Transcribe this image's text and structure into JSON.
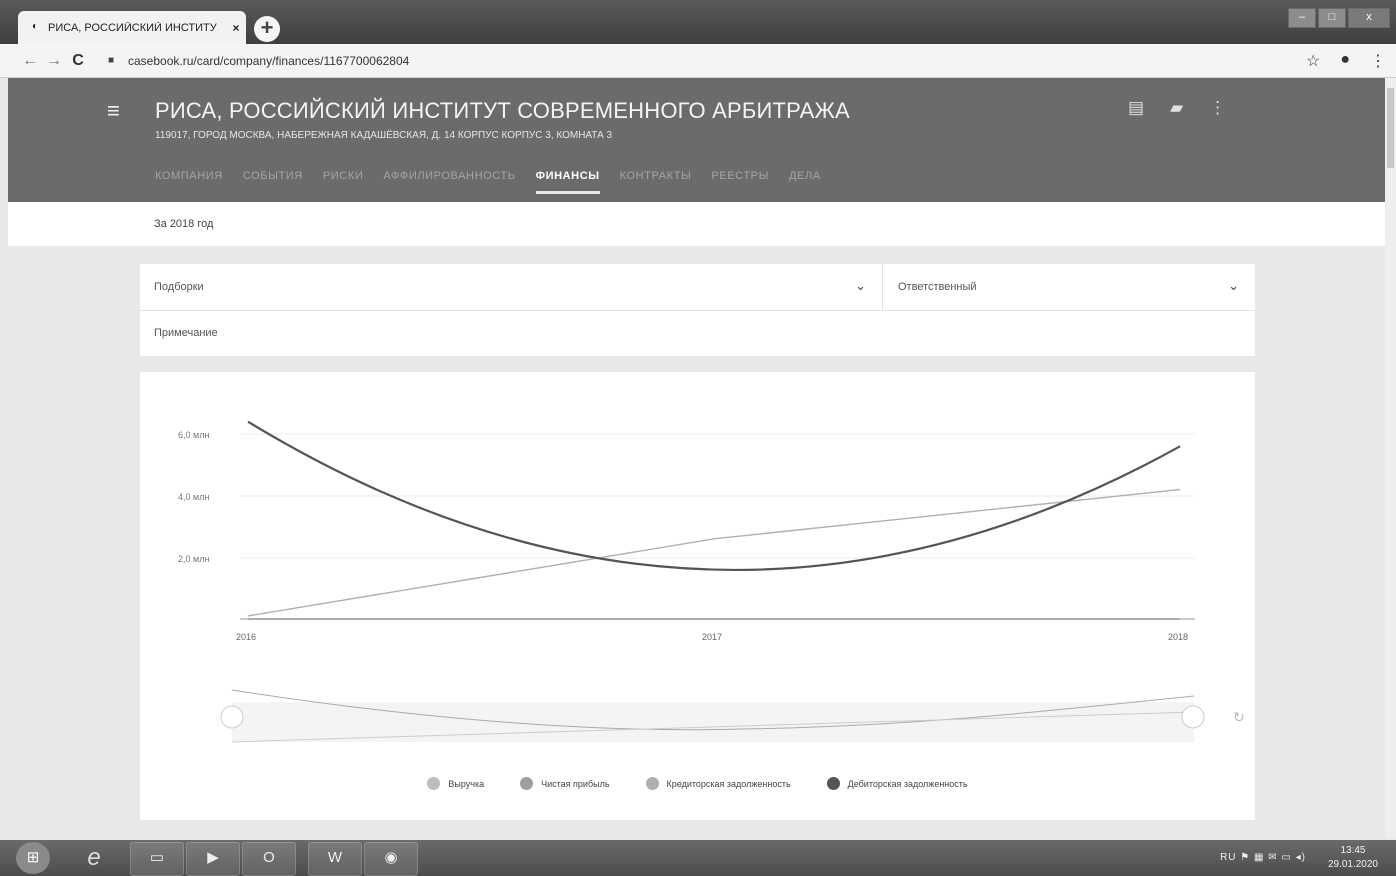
{
  "browser": {
    "tab_title": "РИСА, РОССИЙСКИЙ ИНСТИТУ",
    "tab_close": "×",
    "new_tab": "+",
    "url": "casebook.ru/card/company/finances/1167700062804",
    "window_controls": [
      "–",
      "□",
      "x"
    ]
  },
  "header": {
    "company_name": "РИСА, РОССИЙСКИЙ ИНСТИТУТ СОВРЕМЕННОГО АРБИТРАЖА",
    "address": "119017, ГОРОД МОСКВА, НАБЕРЕЖНАЯ КАДАШЁВСКАЯ, Д. 14 КОРПУС КОРПУС 3, КОМНАТА 3",
    "tabs": [
      {
        "label": "КОМПАНИЯ"
      },
      {
        "label": "СОБЫТИЯ"
      },
      {
        "label": "РИСКИ"
      },
      {
        "label": "АФФИЛИРОВАННОСТЬ"
      },
      {
        "label": "ФИНАНСЫ",
        "active": true
      },
      {
        "label": "КОНТРАКТЫ"
      },
      {
        "label": "РЕЕСТРЫ"
      },
      {
        "label": "ДЕЛА"
      }
    ]
  },
  "period": "За 2018 год",
  "filters": {
    "collections_label": "Подборки",
    "responsible_label": "Ответственный",
    "note_label": "Примечание"
  },
  "chart_data": {
    "type": "line",
    "x": [
      "2016",
      "2017",
      "2018"
    ],
    "y_ticks": [
      "6,0 млн",
      "4,0 млн",
      "2,0 млн"
    ],
    "ylim": [
      0,
      6500000
    ],
    "grid": true,
    "legend_position": "bottom",
    "series": [
      {
        "name": "Выручка",
        "values": [
          0,
          0,
          0
        ],
        "color": "#bdbdbd"
      },
      {
        "name": "Чистая прибыль",
        "values": [
          0,
          0,
          0
        ],
        "color": "#9e9e9e"
      },
      {
        "name": "Кредиторская задолженность",
        "values": [
          100000,
          2600000,
          4200000
        ],
        "color": "#b0b0b0"
      },
      {
        "name": "Дебиторская задолженность",
        "values": [
          6400000,
          1600000,
          5600000
        ],
        "color": "#555555"
      }
    ]
  },
  "taskbar": {
    "lang": "RU",
    "time": "13:45",
    "date": "29.01.2020"
  },
  "colors": {
    "header_bg": "#6b6b6b",
    "page_bg": "#e8e8e8"
  }
}
